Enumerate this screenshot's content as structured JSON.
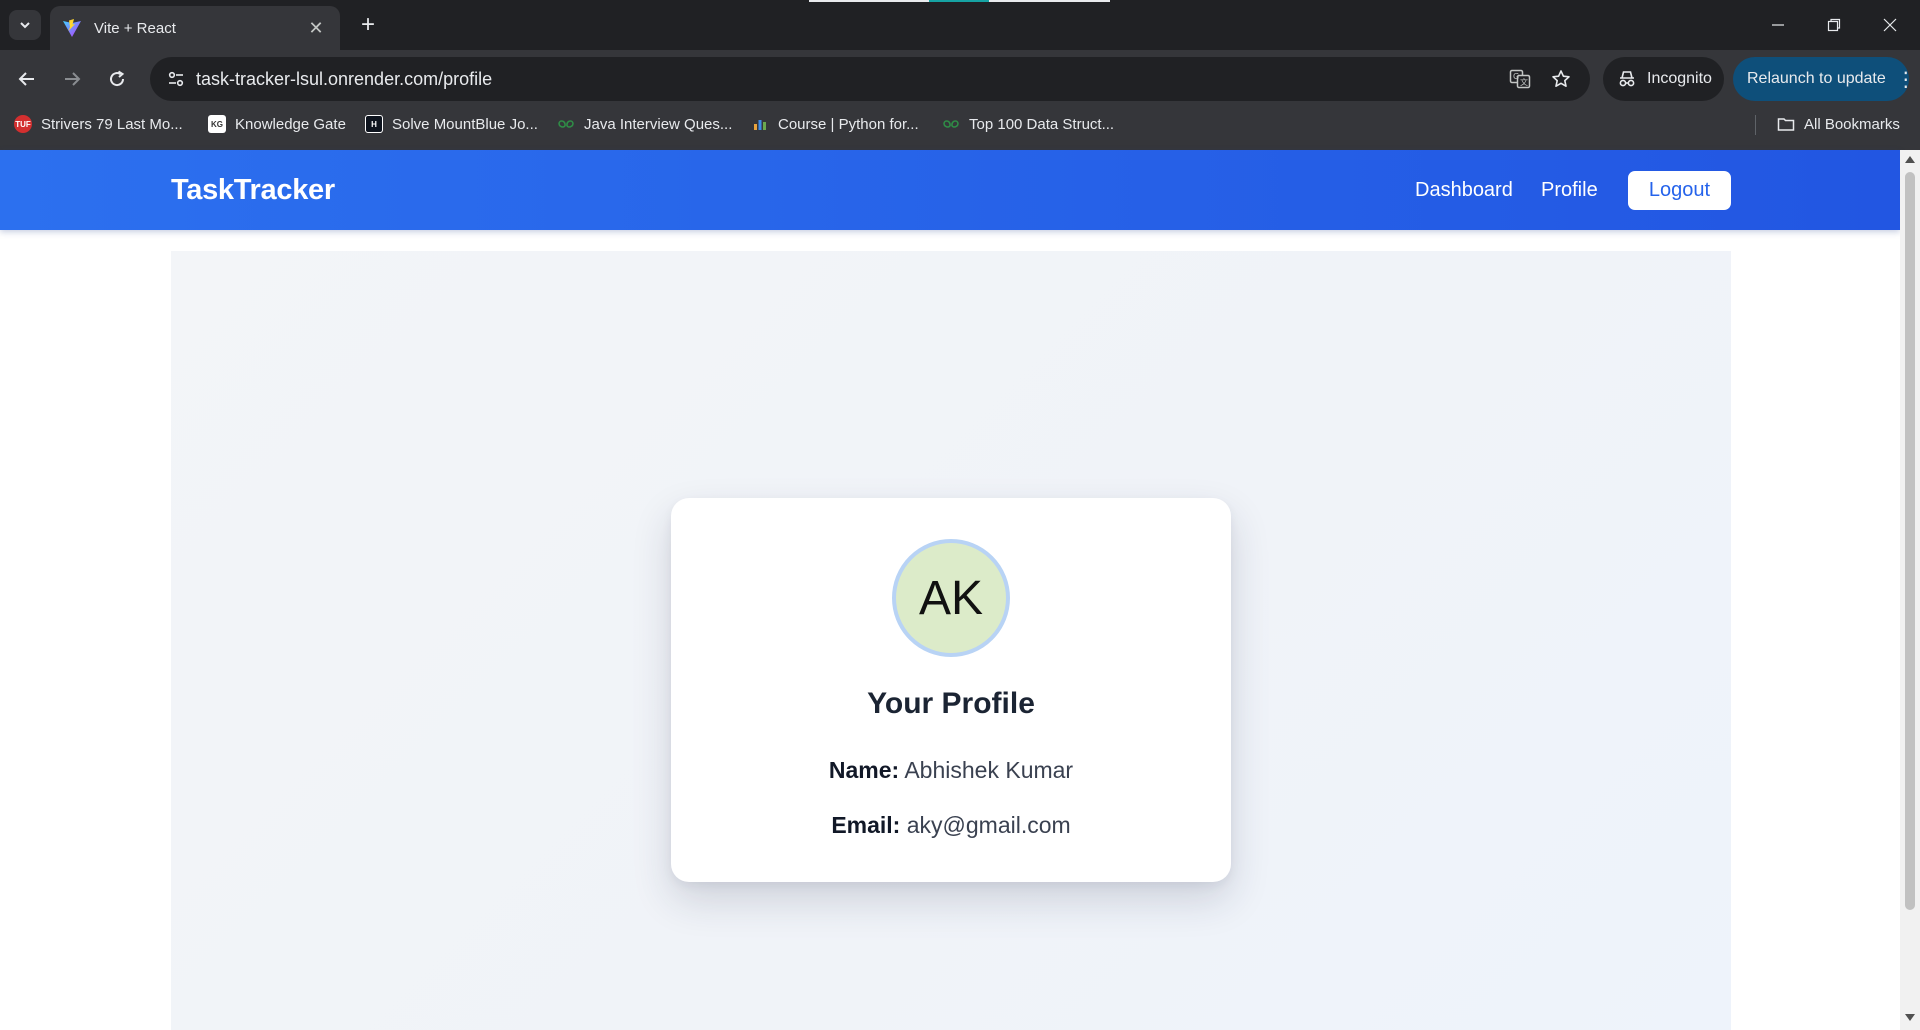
{
  "browser": {
    "tab": {
      "title": "Vite + React",
      "favicon": "vite-logo-icon"
    },
    "address_bar": {
      "url": "task-tracker-lsul.onrender.com/profile"
    },
    "incognito_label": "Incognito",
    "relaunch_label": "Relaunch to update",
    "bookmarks": [
      {
        "label": "Strivers 79 Last Mo...",
        "icon": "tuf-icon",
        "badge": "TUF"
      },
      {
        "label": "Knowledge Gate",
        "icon": "knowledge-gate-icon",
        "badge": "KG"
      },
      {
        "label": "Solve MountBlue Jo...",
        "icon": "hackerrank-icon",
        "badge": "H"
      },
      {
        "label": "Java Interview Ques...",
        "icon": "gfg-icon",
        "badge": ""
      },
      {
        "label": "Course | Python for...",
        "icon": "course-icon",
        "badge": ""
      },
      {
        "label": "Top 100 Data Struct...",
        "icon": "gfg-icon",
        "badge": ""
      }
    ],
    "all_bookmarks_label": "All Bookmarks"
  },
  "app": {
    "brand": "TaskTracker",
    "nav": {
      "dashboard": "Dashboard",
      "profile": "Profile",
      "logout": "Logout"
    },
    "colors": {
      "nav_bg": "#2563eb",
      "avatar_bg": "#dcebc9",
      "avatar_ring": "#b8d3f5"
    }
  },
  "profile": {
    "initials": "AK",
    "title": "Your Profile",
    "name_label": "Name:",
    "name": "Abhishek Kumar",
    "email_label": "Email:",
    "email": "aky@gmail.com"
  }
}
